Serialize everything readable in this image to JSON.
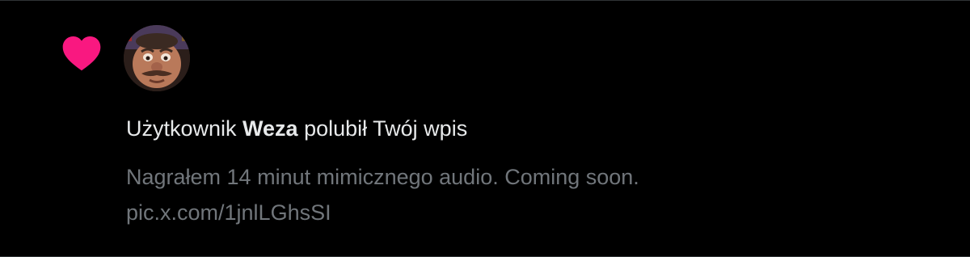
{
  "notification": {
    "type_icon": "heart-icon",
    "avatar_icon": "user-avatar",
    "action_prefix": "Użytkownik",
    "username": "Weza",
    "action_suffix": "polubił Twój wpis",
    "post_line_1": "Nagrałem 14 minut mimicznego audio. Coming soon.",
    "post_line_2": "pic.x.com/1jnlLGhsSI"
  },
  "colors": {
    "background": "#000000",
    "heart": "#f91880",
    "primary_text": "#e7e9ea",
    "secondary_text": "#71767b",
    "divider": "#2f3336"
  }
}
